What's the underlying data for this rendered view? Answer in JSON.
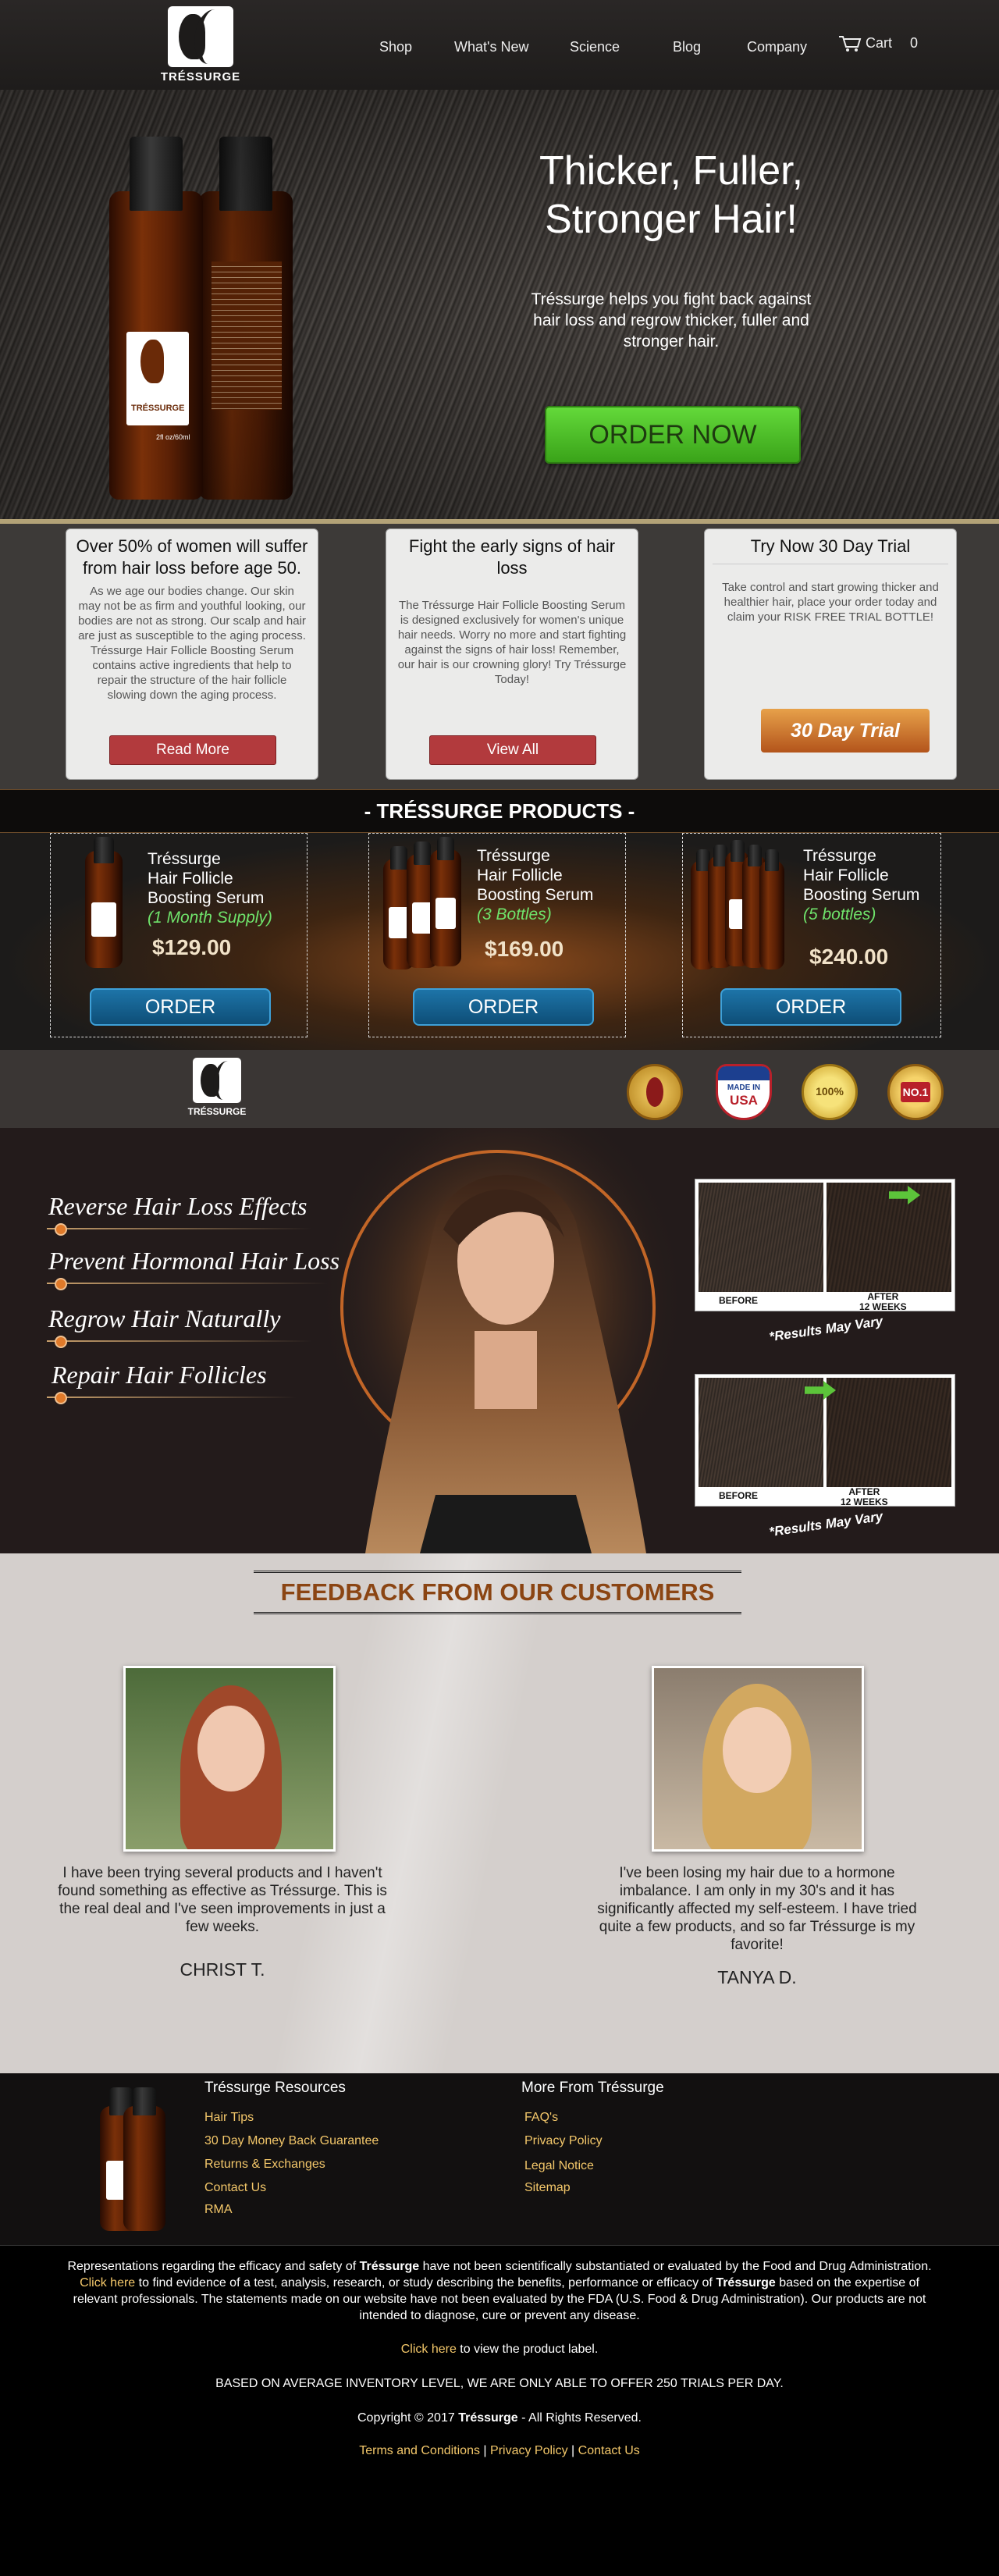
{
  "brand": {
    "name": "TRÉSSURGE"
  },
  "nav": {
    "items": [
      "Shop",
      "What's New",
      "Science",
      "Blog",
      "Company"
    ],
    "cart_label": "Cart",
    "cart_count": "0"
  },
  "hero": {
    "title_line1": "Thicker, Fuller,",
    "title_line2": "Stronger Hair!",
    "subtitle": "Tréssurge helps you fight back against hair loss and regrow thicker, fuller and stronger hair.",
    "cta": "ORDER NOW",
    "bottle_brand": "TRÉSSURGE",
    "bottle_size": "2fl oz/60ml"
  },
  "info_cards": [
    {
      "title": "Over 50% of women will suffer from hair loss before age 50.",
      "body": "As we age our bodies change. Our skin may not be as firm and youthful looking, our bodies are not as strong. Our scalp and hair are just as susceptible to the aging process. Tréssurge Hair Follicle Boosting Serum contains active ingredients that help to repair the structure of the hair follicle slowing down the aging process.",
      "button": "Read More"
    },
    {
      "title": "Fight the early signs of hair loss",
      "body": "The Tréssurge Hair Follicle Boosting Serum is designed exclusively for women's unique hair needs. Worry no more and start fighting against the signs of hair loss! Remember, our hair is our crowning glory! Try Tréssurge Today!",
      "button": "View All"
    },
    {
      "title": "Try Now 30 Day Trial",
      "body": "Take control and start growing thicker and healthier hair, place your order today and claim your RISK FREE TRIAL BOTTLE!",
      "button": "30 Day Trial"
    }
  ],
  "products_heading": "- TRÉSSURGE PRODUCTS -",
  "products": [
    {
      "name_l1": "Tréssurge",
      "name_l2": "Hair Follicle",
      "name_l3": "Boosting Serum",
      "supply": "(1 Month Supply)",
      "price": "$129.00",
      "button": "ORDER"
    },
    {
      "name_l1": "Tréssurge",
      "name_l2": "Hair Follicle",
      "name_l3": "Boosting Serum",
      "supply": "(3 Bottles)",
      "price": "$169.00",
      "button": "ORDER"
    },
    {
      "name_l1": "Tréssurge",
      "name_l2": "Hair Follicle",
      "name_l3": "Boosting Serum",
      "supply": "(5 bottles)",
      "price": "$240.00",
      "button": "ORDER"
    }
  ],
  "badges": {
    "made_in": "MADE IN",
    "usa": "USA",
    "quality": "100%",
    "no1": "NO.1"
  },
  "features": [
    "Reverse Hair Loss Effects",
    "Prevent Hormonal Hair Loss",
    "Regrow Hair Naturally",
    "Repair Hair Follicles"
  ],
  "before_after": {
    "before": "BEFORE",
    "after_l1": "AFTER",
    "after_l2": "12 WEEKS",
    "disclaimer": "*Results May Vary"
  },
  "feedback": {
    "heading": "FEEDBACK FROM OUR CUSTOMERS",
    "testimonials": [
      {
        "quote": "I have been trying several products and I haven't found something as effective as Tréssurge. This is the real deal and I've seen improvements in just a few weeks.",
        "name": "CHRIST T."
      },
      {
        "quote": "I've been losing my hair due to a hormone imbalance. I am only in my 30's and it has significantly affected my self-esteem. I have tried quite a few products, and so far Tréssurge is my favorite!",
        "name": "TANYA D."
      }
    ]
  },
  "footer": {
    "resources_title": "Tréssurge Resources",
    "resources": [
      "Hair Tips",
      "30 Day Money Back Guarantee",
      "Returns & Exchanges",
      "Contact Us",
      "RMA"
    ],
    "more_title": "More From Tréssurge",
    "more": [
      "FAQ's",
      "Privacy Policy",
      "Legal Notice",
      "Sitemap"
    ]
  },
  "legal": {
    "p1a": "Representations regarding the efficacy and safety of",
    "p1b": "Tréssurge",
    "p1c": "have not been scientifically substantiated or evaluated by the Food and Drug Administration.",
    "p1d": "Click here",
    "p1e": "to find evidence of a test, analysis, research, or study describing the benefits, performance or efficacy of",
    "p1f": "Tréssurge",
    "p1g": "based on the expertise of relevant professionals. The statements made on our website have not been evaluated by the FDA (U.S. Food & Drug Administration). Our products are not intended to diagnose, cure or prevent any disease.",
    "p2a": "Click here",
    "p2b": "to view the product label.",
    "p3": "BASED ON AVERAGE INVENTORY LEVEL, WE ARE ONLY ABLE TO OFFER 250 TRIALS PER DAY.",
    "p4a": "Copyright © 2017",
    "p4b": "Tréssurge",
    "p4c": "- All Rights Reserved.",
    "links": [
      "Terms and Conditions",
      "Privacy Policy",
      "Contact Us"
    ]
  },
  "colors": {
    "accent_green": "#4cc42a",
    "button_red": "#b23a3d",
    "button_blue": "#1d74a8",
    "gold_link": "#f3c76a",
    "feedback_title": "#8b4513"
  }
}
